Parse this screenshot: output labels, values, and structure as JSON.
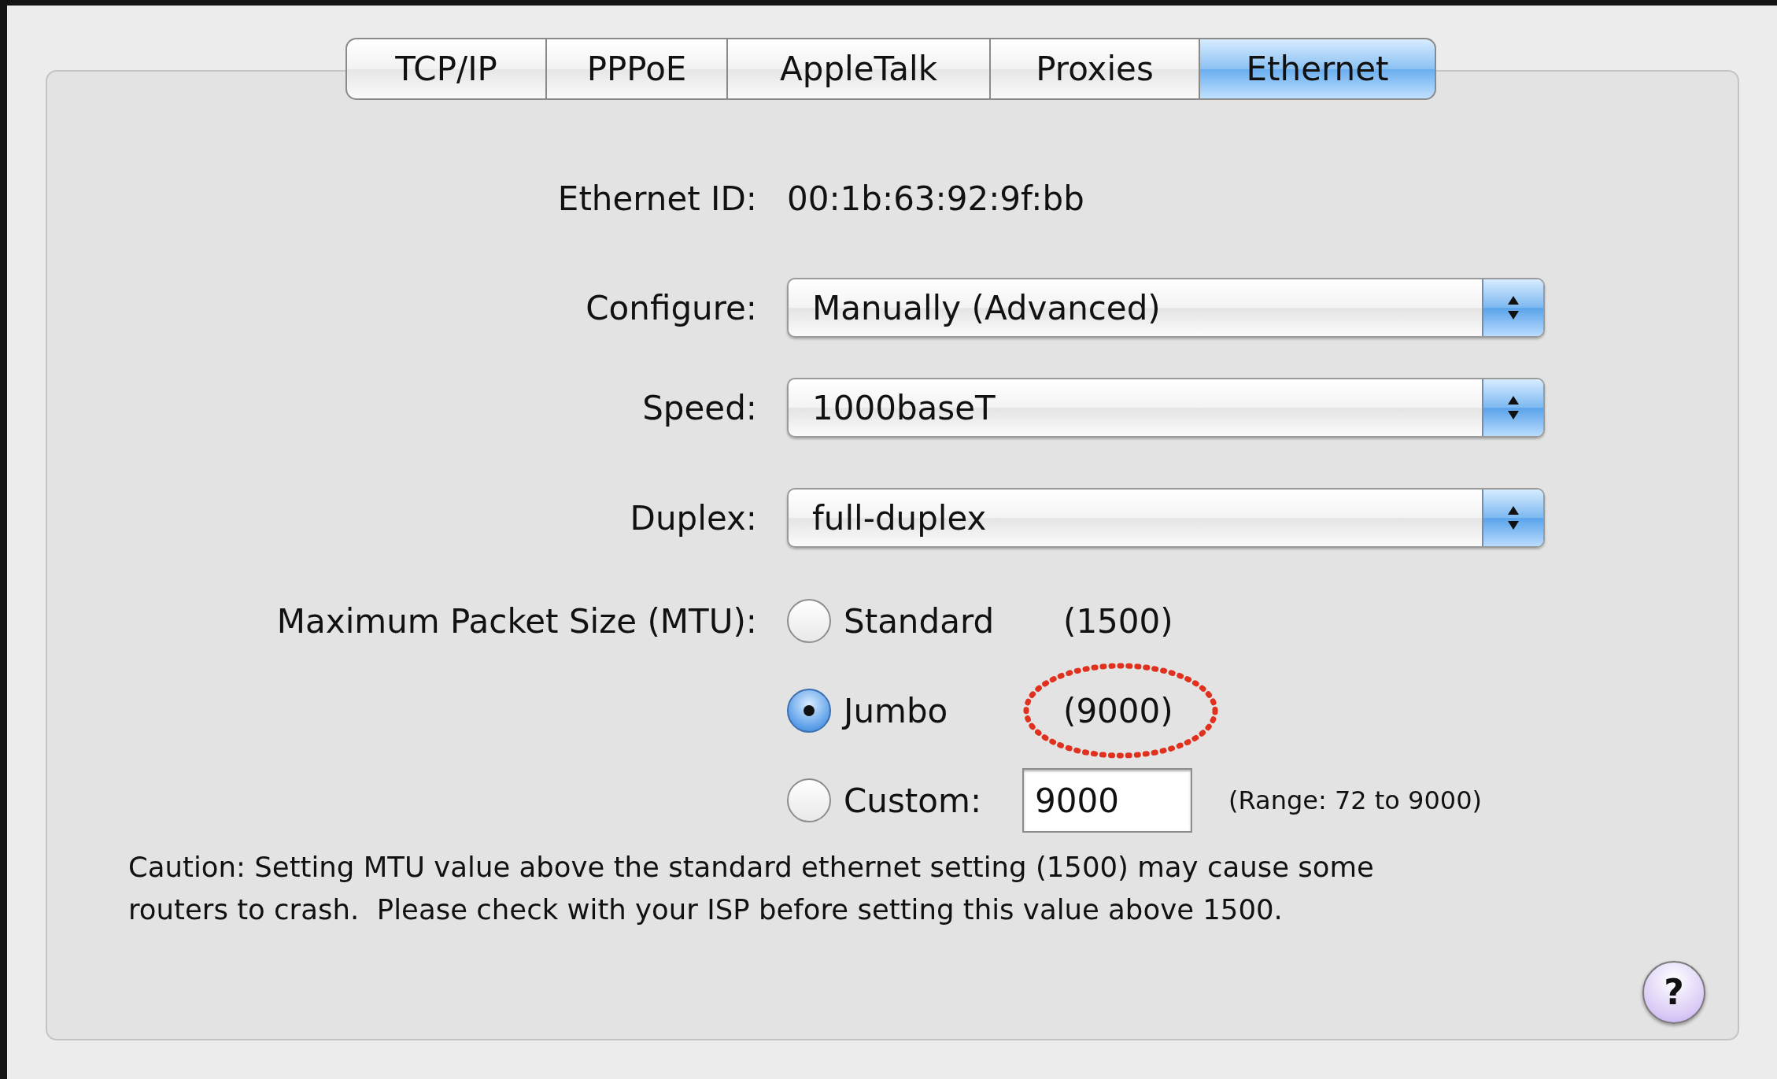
{
  "tabs": [
    {
      "label": "TCP/IP",
      "selected": false
    },
    {
      "label": "PPPoE",
      "selected": false
    },
    {
      "label": "AppleTalk",
      "selected": false
    },
    {
      "label": "Proxies",
      "selected": false
    },
    {
      "label": "Ethernet",
      "selected": true
    }
  ],
  "ethernet_id": {
    "label": "Ethernet ID:",
    "value": "00:1b:63:92:9f:bb"
  },
  "popups": [
    {
      "label": "Configure:",
      "value": "Manually (Advanced)"
    },
    {
      "label": "Speed:",
      "value": "1000baseT"
    },
    {
      "label": "Duplex:",
      "value": "full-duplex"
    }
  ],
  "mtu": {
    "label": "Maximum Packet Size (MTU):",
    "options": [
      {
        "kind": "preset",
        "label": "Standard",
        "value": "(1500)",
        "selected": false,
        "circled": false
      },
      {
        "kind": "preset",
        "label": "Jumbo",
        "value": "(9000)",
        "selected": true,
        "circled": true
      },
      {
        "kind": "custom",
        "label": "Custom:",
        "field_value": "9000",
        "note": "(Range: 72 to 9000)",
        "selected": false
      }
    ]
  },
  "caution": "Caution: Setting MTU value above the standard ethernet setting (1500) may cause some\nrouters to crash.  Please check with your ISP before setting this value above 1500.",
  "help_button": "?"
}
